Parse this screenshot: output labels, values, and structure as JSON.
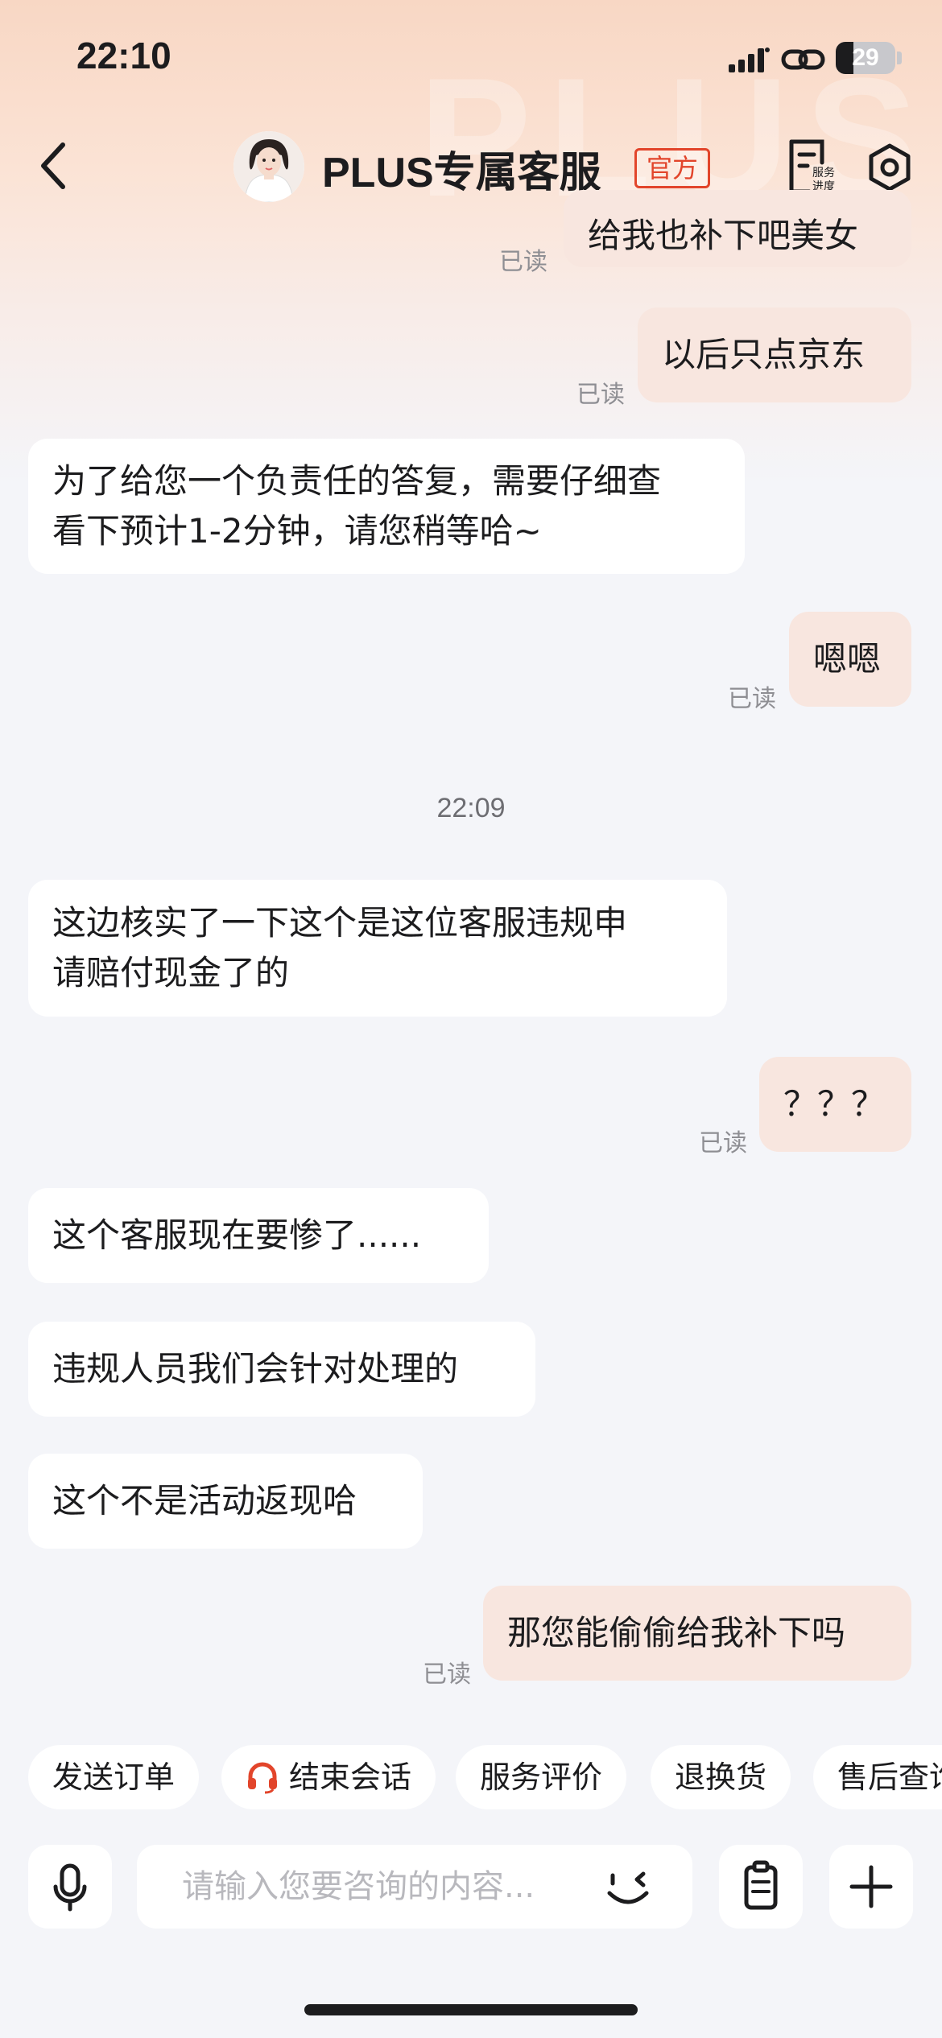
{
  "status_bar": {
    "time": "22:10",
    "battery": "29"
  },
  "header": {
    "title": "PLUS专属客服",
    "badge": "官方",
    "watermark": "PLUS",
    "progress_label_line1": "服务",
    "progress_label_line2": "进度"
  },
  "messages": [
    {
      "side": "out",
      "text": "给我也补下吧美女",
      "read": "已读"
    },
    {
      "side": "out",
      "text": "以后只点京东",
      "read": "已读"
    },
    {
      "side": "in",
      "line1": "为了给您一个负责任的答复，需要仔细查",
      "line2": "看下预计1-2分钟，请您稍等哈~"
    },
    {
      "side": "out",
      "text": "嗯嗯",
      "read": "已读"
    },
    {
      "side": "in",
      "line1": "这边核实了一下这个是这位客服违规申",
      "line2": "请赔付现金了的"
    },
    {
      "side": "out",
      "text": "？？？",
      "read": "已读"
    },
    {
      "side": "in",
      "text": "这个客服现在要惨了......"
    },
    {
      "side": "in",
      "text": "违规人员我们会针对处理的"
    },
    {
      "side": "in",
      "text": "这个不是活动返现哈"
    },
    {
      "side": "out",
      "text": "那您能偷偷给我补下吗",
      "read": "已读"
    }
  ],
  "timestamp": "22:09",
  "quick_actions": [
    "发送订单",
    "结束会话",
    "服务评价",
    "退换货",
    "售后查询"
  ],
  "input": {
    "placeholder": "请输入您要咨询的内容..."
  },
  "colors": {
    "accent_red": "#e2452b",
    "outgoing_bubble": "#f8e6df",
    "incoming_bubble": "#ffffff",
    "background": "#f4f5f9"
  }
}
